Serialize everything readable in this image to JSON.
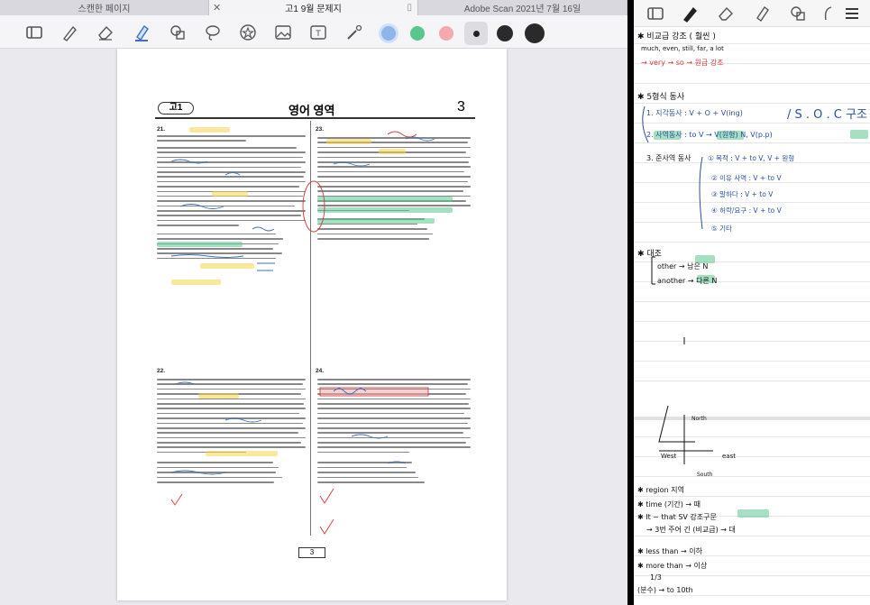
{
  "tabs": [
    {
      "label": "스캔한 페이지",
      "active": false
    },
    {
      "label": "고1 9월 문제지",
      "active": true
    },
    {
      "label": "Adobe Scan 2021년 7월 16일",
      "active": false
    }
  ],
  "toolbar": {
    "tools": [
      "sidebar-icon",
      "pen-icon",
      "eraser-icon",
      "highlighter-icon",
      "shapes-icon",
      "lasso-icon",
      "sticker-icon",
      "image-icon",
      "textbox-icon",
      "laser-icon"
    ],
    "colors": [
      "#8fb5e8",
      "#5cc48f",
      "#f3a9ad"
    ]
  },
  "document": {
    "grade_label": "고1",
    "subject": "영어 영역",
    "page_number": "3",
    "q21": "21.",
    "q22": "22.",
    "q23": "23.",
    "q24": "24.",
    "footer_page": "3"
  },
  "notes": {
    "tools": [
      "sidebar-icon",
      "pen-icon",
      "eraser-icon",
      "highlighter-icon",
      "shapes-icon",
      "lasso-icon",
      "menu-icon"
    ],
    "lines": {
      "heading1": "✱ 비교급 강조 ( 훨씬 )",
      "line1b": "much, even, still, far, a lot",
      "line1c": "→ very → so → 원급 강조",
      "heading2": "✱ 5형식 동사",
      "item1": "1. 지각동사 : V + O + V(ing)",
      "item1b": "/ S . O . C 구조",
      "item2": "2. 사역동사 : to V → V(원형) N, V(p.p)",
      "item3": "3. 준사역 동사",
      "item3a": "① 목적 : V + to V, V + 원형",
      "item3b": "② 이유 사역 : V + to V",
      "item3c": "③ 말하다 : V + to V",
      "item3d": "④ 허락/요구 : V + to V",
      "item3e": "⑤ 기타",
      "heading3": "✱ 대조",
      "contrast1": "other → 남은 N",
      "contrast2": "another → 다른 N",
      "compass_north": "North",
      "compass_west": "West",
      "compass_east": "east",
      "compass_south": "South",
      "b1": "✱ region 지역",
      "b2": "✱ time (기간) → 때",
      "b3": "✱ It ~ that SV 강조구문",
      "b3b": "→ 3번 주어 긴 (비교급) → 대",
      "b4": "✱ less than → 이하",
      "b5": "✱ more than → 이상",
      "b6": "1/3",
      "b7": "(분수)  → to 10th"
    }
  }
}
